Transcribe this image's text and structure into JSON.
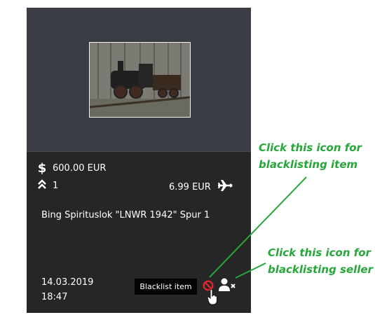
{
  "item": {
    "price": "600.00 EUR",
    "bids": "1",
    "shipping": "6.99 EUR",
    "title": "Bing Spirituslok \"LNWR 1942\" Spur 1",
    "date": "14.03.2019",
    "time": "18:47"
  },
  "tooltip": "Blacklist item",
  "annotations": {
    "item_line1": "Click this icon for",
    "item_line2": "blacklisting item",
    "seller_line1": "Click this icon for",
    "seller_line2": "blacklisting seller"
  },
  "colors": {
    "card": "#262626",
    "card_top": "#3a3d44",
    "annotation": "#27a63a",
    "blacklist": "#e0262f"
  },
  "icons": [
    "dollar-icon",
    "chevrons-up-icon",
    "airplane-icon",
    "block-icon",
    "user-x-icon",
    "hand-cursor-icon"
  ]
}
